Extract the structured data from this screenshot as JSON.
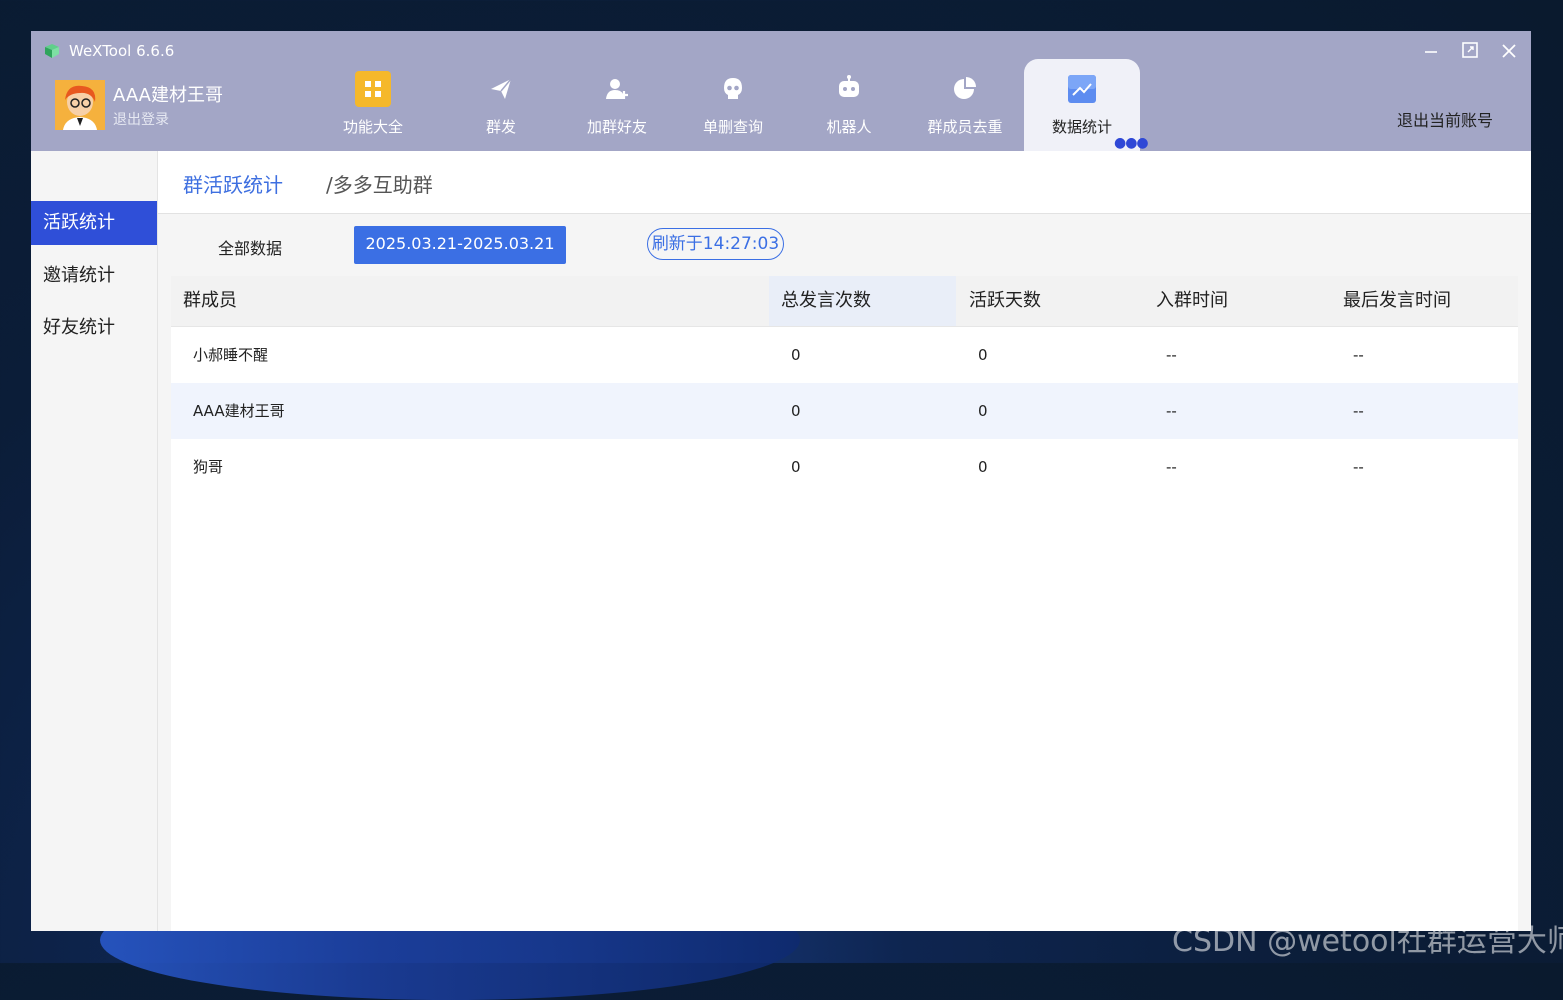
{
  "window": {
    "title": "WeXTool 6.6.6"
  },
  "user": {
    "name": "AAA建材王哥",
    "logout": "退出登录"
  },
  "nav": [
    {
      "label": "功能大全",
      "icon": "grid-icon"
    },
    {
      "label": "群发",
      "icon": "send-icon"
    },
    {
      "label": "加群好友",
      "icon": "add-user-icon"
    },
    {
      "label": "单删查询",
      "icon": "skull-icon"
    },
    {
      "label": "机器人",
      "icon": "robot-icon"
    },
    {
      "label": "群成员去重",
      "icon": "pie-icon"
    },
    {
      "label": "数据统计",
      "icon": "chart-icon",
      "active": true
    }
  ],
  "switch_account": "退出当前账号",
  "sidebar": {
    "items": [
      "活跃统计",
      "邀请统计",
      "好友统计"
    ],
    "active_index": 0
  },
  "header": {
    "title": "群活跃统计",
    "group": "/多多互助群"
  },
  "filter": {
    "all_data": "全部数据",
    "date_range": "2025.03.21-2025.03.21",
    "refreshed": "刷新于14:27:03"
  },
  "table": {
    "columns": [
      "群成员",
      "总发言次数",
      "活跃天数",
      "入群时间",
      "最后发言时间"
    ],
    "rows": [
      [
        "小郝睡不醒",
        "0",
        "0",
        "--",
        "--"
      ],
      [
        "AAA建材王哥",
        "0",
        "0",
        "--",
        "--"
      ],
      [
        "狗哥",
        "0",
        "0",
        "--",
        "--"
      ]
    ]
  },
  "watermark": "CSDN @wetool社群运营大师",
  "colors": {
    "titlebar": "#a3a6c6",
    "accent": "#3b6fe4",
    "sidebar_active": "#2f4fd8"
  }
}
